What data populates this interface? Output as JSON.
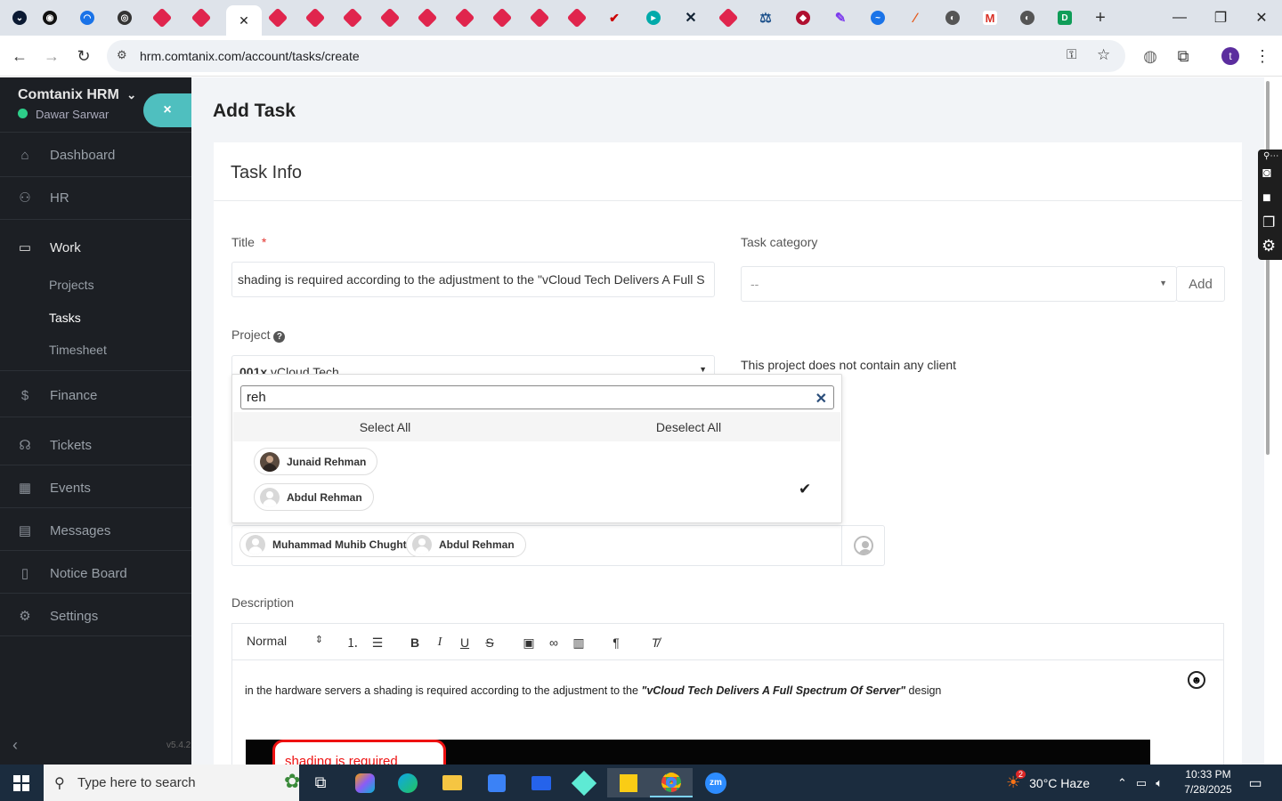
{
  "browser": {
    "url": "hrm.comtanix.com/account/tasks/create",
    "profile_initial": "t"
  },
  "sidebar": {
    "brand": "Comtanix HRM",
    "user": "Dawar Sarwar",
    "close_label": "×",
    "version": "v5.4.2",
    "items": [
      {
        "label": "Dashboard",
        "icon": "home-icon"
      },
      {
        "label": "HR",
        "icon": "users-icon"
      },
      {
        "label": "Work",
        "icon": "briefcase-icon"
      },
      {
        "label": "Finance",
        "icon": "dollar-icon"
      },
      {
        "label": "Tickets",
        "icon": "headset-icon"
      },
      {
        "label": "Events",
        "icon": "calendar-icon"
      },
      {
        "label": "Messages",
        "icon": "message-icon"
      },
      {
        "label": "Notice Board",
        "icon": "clipboard-icon"
      },
      {
        "label": "Settings",
        "icon": "gear-icon"
      }
    ],
    "subitems": [
      "Projects",
      "Tasks",
      "Timesheet"
    ]
  },
  "page": {
    "title": "Add Task",
    "card_title": "Task Info",
    "title_label": "Title",
    "required_mark": "*",
    "title_value": "shading is required according to the adjustment to the \"vCloud Tech Delivers A Full S",
    "category_label": "Task category",
    "category_value": "--",
    "category_add": "Add",
    "project_label": "Project",
    "project_code": "001x",
    "project_name": "vCloud Tech",
    "client_note": "This project does not contain any client",
    "description_label": "Description"
  },
  "dropdown": {
    "search_value": "reh",
    "select_all": "Select All",
    "deselect_all": "Deselect All",
    "options": [
      {
        "name": "Junaid Rehman",
        "selected": false
      },
      {
        "name": "Abdul Rehman",
        "selected": true
      }
    ]
  },
  "members": [
    "Muhammad Muhib Chughtai",
    "Abdul Rehman"
  ],
  "editor": {
    "format": "Normal",
    "text_before": "in the hardware servers a shading is required according to the adjustment to the ",
    "text_bold": "\"vCloud Tech Delivers A Full Spectrum Of Server\"",
    "text_after": " design",
    "callout": "shading is required"
  },
  "taskbar": {
    "search_placeholder": "Type here to search",
    "weather": "30°C  Haze",
    "weather_badge": "2",
    "time": "10:33 PM",
    "date": "7/28/2025"
  },
  "colors": {
    "accent": "#4fbfbf",
    "sidebar_bg": "#1c1f24",
    "required": "#e3342f"
  }
}
